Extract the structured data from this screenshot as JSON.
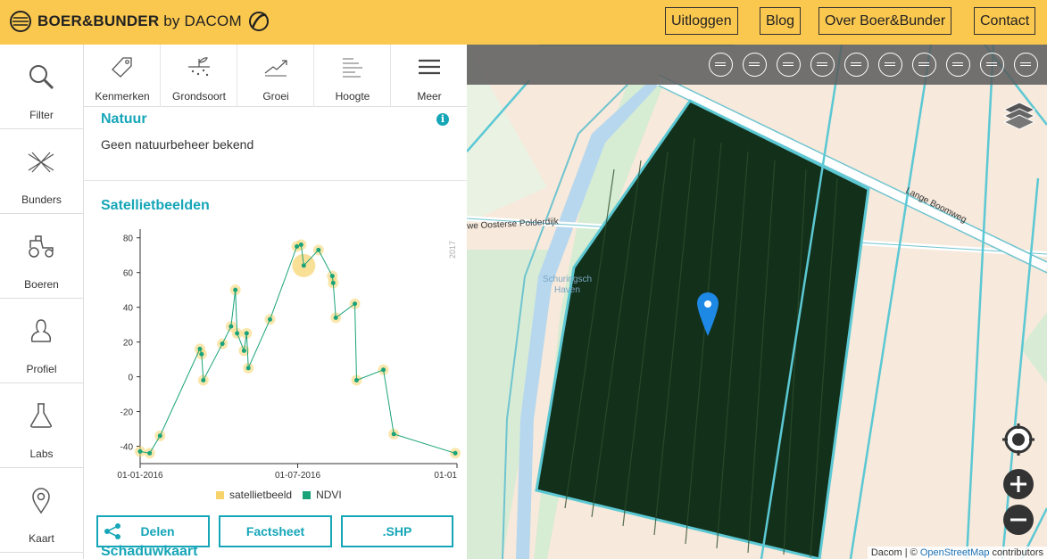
{
  "header": {
    "logo_text": "BOER&BUNDER",
    "logo_by": "by DACOM",
    "nav": [
      "Uitloggen",
      "Blog",
      "Over Boer&Bunder",
      "Contact"
    ]
  },
  "sidebar": {
    "items": [
      {
        "label": "Filter",
        "icon": "search-icon"
      },
      {
        "label": "Bunders",
        "icon": "bunders-icon"
      },
      {
        "label": "Boeren",
        "icon": "tractor-icon"
      },
      {
        "label": "Profiel",
        "icon": "profile-icon"
      },
      {
        "label": "Labs",
        "icon": "flask-icon"
      },
      {
        "label": "Kaart",
        "icon": "map-pin-icon"
      }
    ]
  },
  "tabs": [
    {
      "label": "Kenmerken",
      "icon": "tag-icon"
    },
    {
      "label": "Grondsoort",
      "icon": "soil-icon"
    },
    {
      "label": "Groei",
      "icon": "growth-icon"
    },
    {
      "label": "Hoogte",
      "icon": "height-icon"
    },
    {
      "label": "Meer",
      "icon": "menu-icon"
    }
  ],
  "natuur": {
    "title": "Natuur",
    "text": "Geen natuurbeheer bekend",
    "info_glyph": "i"
  },
  "satellite": {
    "title": "Satellietbeelden"
  },
  "chart_data": {
    "type": "line",
    "series": [
      {
        "name": "NDVI",
        "color": "#1aa37a",
        "x": [
          "2016-01-01",
          "2016-01-12",
          "2016-01-24",
          "2016-03-10",
          "2016-03-12",
          "2016-03-14",
          "2016-04-05",
          "2016-04-15",
          "2016-04-20",
          "2016-04-22",
          "2016-04-30",
          "2016-05-03",
          "2016-05-05",
          "2016-05-30",
          "2016-06-30",
          "2016-07-05",
          "2016-07-08",
          "2016-07-25",
          "2016-08-10",
          "2016-08-11",
          "2016-08-14",
          "2016-09-05",
          "2016-09-07",
          "2016-10-08",
          "2016-10-20",
          "2016-12-30"
        ],
        "values": [
          -43,
          -44,
          -34,
          16,
          13,
          -2,
          19,
          29,
          50,
          25,
          15,
          25,
          5,
          33,
          75,
          76,
          64,
          73,
          58,
          54,
          34,
          42,
          -2,
          4,
          -33,
          -44
        ]
      }
    ],
    "satellietbeeld_points": [
      {
        "x": "2016-01-01",
        "y": -43
      },
      {
        "x": "2016-01-12",
        "y": -44
      },
      {
        "x": "2016-01-24",
        "y": -34
      },
      {
        "x": "2016-03-10",
        "y": 16
      },
      {
        "x": "2016-03-12",
        "y": 13
      },
      {
        "x": "2016-03-14",
        "y": -2
      },
      {
        "x": "2016-04-05",
        "y": 19
      },
      {
        "x": "2016-04-15",
        "y": 29
      },
      {
        "x": "2016-04-20",
        "y": 50
      },
      {
        "x": "2016-04-22",
        "y": 25
      },
      {
        "x": "2016-04-30",
        "y": 15
      },
      {
        "x": "2016-05-03",
        "y": 25
      },
      {
        "x": "2016-05-05",
        "y": 5
      },
      {
        "x": "2016-05-30",
        "y": 33
      },
      {
        "x": "2016-06-30",
        "y": 75
      },
      {
        "x": "2016-07-05",
        "y": 76
      },
      {
        "x": "2016-07-08",
        "y": 64,
        "highlight": true
      },
      {
        "x": "2016-07-25",
        "y": 73
      },
      {
        "x": "2016-08-10",
        "y": 58
      },
      {
        "x": "2016-08-11",
        "y": 54
      },
      {
        "x": "2016-08-14",
        "y": 34
      },
      {
        "x": "2016-09-05",
        "y": 42
      },
      {
        "x": "2016-09-07",
        "y": -2
      },
      {
        "x": "2016-10-08",
        "y": 4
      },
      {
        "x": "2016-10-20",
        "y": -33
      },
      {
        "x": "2016-12-30",
        "y": -44
      }
    ],
    "yticks": [
      80,
      60,
      40,
      20,
      0,
      -20,
      -40
    ],
    "ylim": [
      -50,
      85
    ],
    "xticks": [
      {
        "label": "01-01-2016",
        "x": "2016-01-01"
      },
      {
        "label": "01-07-2016",
        "x": "2016-07-01"
      },
      {
        "label": "01-01",
        "x": "2017-01-01"
      }
    ],
    "xlim": [
      "2016-01-01",
      "2017-01-01"
    ],
    "year_label": "2017",
    "legend": [
      {
        "label": "satellietbeeld",
        "color": "#f6d36b"
      },
      {
        "label": "NDVI",
        "color": "#1aa37a"
      }
    ]
  },
  "actions": {
    "share": "Delen",
    "factsheet": "Factsheet",
    "shp": ".SHP"
  },
  "next_section": "Schaduwkaart",
  "map": {
    "road1": "Lange Boomweg",
    "road2": "we Oosterse Polderdijk",
    "harbour1": "Schuringsch",
    "harbour2": "Haven",
    "attrib_dacom": "Dacom",
    "attrib_sep": " | © ",
    "attrib_osm": "OpenStreetMap",
    "attrib_tail": " contributors",
    "tools": [
      "pin-layer-icon",
      "field-layer-icon",
      "crop-layer-icon",
      "drone-icon",
      "water-icon",
      "layers-stack-icon",
      "wave-icon",
      "farmer-icon",
      "road-icon",
      "list-icon"
    ]
  },
  "colors": {
    "brand": "#fbc84f",
    "accent": "#16a6b8"
  }
}
